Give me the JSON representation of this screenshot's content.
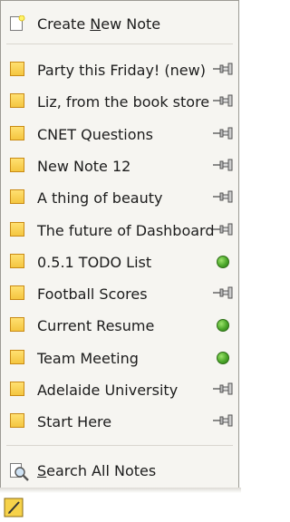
{
  "menu": {
    "create_note": {
      "prefix": "Create ",
      "mnemonic": "N",
      "suffix": "ew Note",
      "icon": "new-note-icon"
    },
    "notes": [
      {
        "label": "Party this Friday! (new)",
        "status": "pin-icon"
      },
      {
        "label": "Liz, from the book store",
        "status": "pin-icon"
      },
      {
        "label": "CNET Questions",
        "status": "pin-icon"
      },
      {
        "label": "New Note 12",
        "status": "pin-icon"
      },
      {
        "label": "A thing of beauty",
        "status": "pin-icon"
      },
      {
        "label": "The future of Dashboard",
        "status": "pin-icon"
      },
      {
        "label": "0.5.1 TODO List",
        "status": "green-dot-icon"
      },
      {
        "label": "Football Scores",
        "status": "pin-icon"
      },
      {
        "label": "Current Resume",
        "status": "green-dot-icon"
      },
      {
        "label": "Team Meeting",
        "status": "green-dot-icon"
      },
      {
        "label": "Adelaide University",
        "status": "pin-icon"
      },
      {
        "label": "Start Here",
        "status": "pin-icon"
      }
    ],
    "search": {
      "mnemonic": "S",
      "suffix": "earch All Notes",
      "icon": "search-notes-icon"
    }
  },
  "colors": {
    "note_icon": "#f4c640",
    "note_icon_border": "#c98a14",
    "pinned_dot": "#4ba62a",
    "menu_bg": "#f6f5f1"
  }
}
